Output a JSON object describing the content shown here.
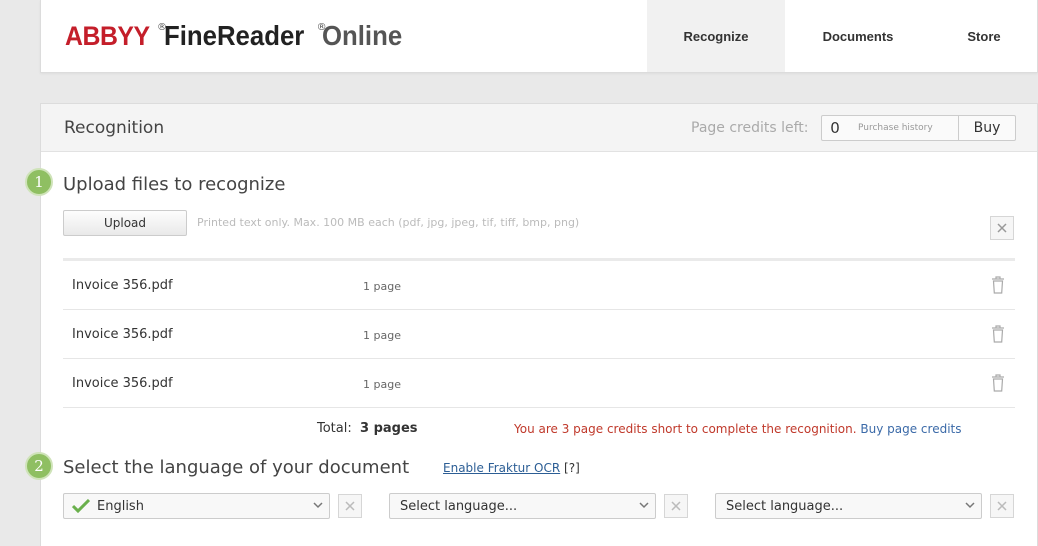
{
  "logo": {
    "brand": "ABBYY",
    "reg1": "®",
    "product": "FineReader",
    "reg2": "®",
    "suffix": "Online"
  },
  "nav": {
    "tabs": [
      {
        "label": "Recognize"
      },
      {
        "label": "Documents"
      },
      {
        "label": "Store"
      }
    ],
    "active": "Recognize"
  },
  "panel": {
    "title": "Recognition",
    "credits_label": "Page credits left:",
    "credits_value": "0",
    "purchase_history": "Purchase history",
    "buy": "Buy"
  },
  "step1": {
    "number": "1",
    "title": "Upload files to recognize",
    "upload_button": "Upload",
    "hint": "Printed text only. Max. 100 MB each (pdf, jpg, jpeg, tif, tiff, bmp, png)",
    "clear_icon": "close-icon"
  },
  "files": [
    {
      "name": "Invoice 356.pdf",
      "pages": "1 page"
    },
    {
      "name": "Invoice 356.pdf",
      "pages": "1 page"
    },
    {
      "name": "Invoice 356.pdf",
      "pages": "1 page"
    }
  ],
  "summary": {
    "total_label": "Total:",
    "total_value": "3 pages",
    "warning": "You are 3 page credits short to complete the recognition.",
    "buy_link": "Buy page credits"
  },
  "step2": {
    "number": "2",
    "title": "Select the language of your document",
    "fraktur_link": "Enable Fraktur OCR",
    "fraktur_help": "[?]",
    "languages": [
      {
        "value": "English",
        "selected": true
      },
      {
        "value": "Select language...",
        "selected": false
      },
      {
        "value": "Select language...",
        "selected": false
      }
    ]
  },
  "colors": {
    "brand_red": "#c41e2a",
    "step_green": "#8fbf62",
    "warning_red": "#c0392b",
    "link_blue": "#3b6aa8",
    "check_green": "#6ab04c"
  }
}
